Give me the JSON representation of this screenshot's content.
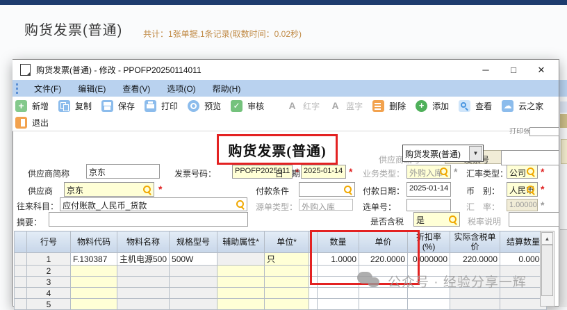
{
  "page": {
    "title": "购货发票(普通)",
    "summary": "共计：1张单据,1条记录(取数时间：0.02秒)"
  },
  "window": {
    "title": "购货发票(普通) - 修改 - PPOFP20250114011",
    "minimize": "─",
    "maximize": "□",
    "close": "✕",
    "menu": [
      "文件(F)",
      "编辑(E)",
      "查看(V)",
      "选项(O)",
      "帮助(H)"
    ],
    "toolbar_row1": [
      {
        "icon": "new-icon",
        "label": "新增"
      },
      {
        "icon": "copy-icon",
        "label": "复制"
      },
      {
        "icon": "save-icon",
        "label": "保存"
      },
      {
        "icon": "print-icon",
        "label": "打印"
      },
      {
        "icon": "preview-icon",
        "label": "预览"
      },
      {
        "icon": "audit-icon",
        "label": "审核"
      },
      {
        "icon": "letter-a-icon",
        "label": "红字",
        "disabled": true
      },
      {
        "icon": "letter-a-icon",
        "label": "蓝字",
        "disabled": true
      },
      {
        "icon": "delete-icon",
        "label": "删除"
      },
      {
        "icon": "add-icon",
        "label": "添加"
      },
      {
        "icon": "magnifier-icon",
        "label": "查看"
      },
      {
        "icon": "cloud-icon",
        "label": "云之家"
      }
    ],
    "toolbar_row2": [
      {
        "icon": "exit-icon",
        "label": "退出"
      }
    ]
  },
  "form": {
    "banner": "购货发票(普通)",
    "bill_type_value": "购货发票(普通)",
    "print_count_label": "打印张数",
    "fields": {
      "supplier_no": {
        "label": "供应商编号",
        "value": ""
      },
      "invoice_no": {
        "label": "发票号",
        "value": ""
      },
      "supplier_abbr": {
        "label": "供应商简称",
        "value": "京东"
      },
      "invoice_code": {
        "label": "发票号码：",
        "value": "PPOFP2025011"
      },
      "date": {
        "label": "日　期：",
        "value": "2025-01-14"
      },
      "biz_type": {
        "label": "业务类型：",
        "value": "外购入库"
      },
      "rate_type": {
        "label": "汇率类型：",
        "value": "公司"
      },
      "supplier": {
        "label": "供应商",
        "value": "京东"
      },
      "pay_terms": {
        "label": "付款条件",
        "value": ""
      },
      "pay_date": {
        "label": "付款日期：",
        "value": "2025-01-14"
      },
      "currency": {
        "label": "币　别：",
        "value": "人民币"
      },
      "account": {
        "label": "往来科目：",
        "value": "应付账款_人民币_货款"
      },
      "source_type": {
        "label": "源单类型：",
        "value": "外购入库"
      },
      "select_no": {
        "label": "选单号：",
        "value": ""
      },
      "ex_rate": {
        "label": "汇　率：",
        "value": "1.000000"
      },
      "summary": {
        "label": "摘要：",
        "value": ""
      },
      "tax_included": {
        "label": "是否含税",
        "value": "是"
      },
      "tax_note": {
        "label": "税率说明",
        "value": ""
      }
    }
  },
  "table": {
    "columns": [
      "行号",
      "物料代码",
      "物料名称",
      "规格型号",
      "辅助属性*",
      "单位*",
      "数量",
      "单价",
      "折扣率(%)",
      "实际含税单价",
      "结算数量"
    ],
    "rows": [
      {
        "cells": [
          "1",
          "F.130387",
          "主机电源500",
          "500W",
          "",
          "只",
          "1.0000",
          "220.0000",
          "0.000000",
          "220.0000",
          "0.0000"
        ]
      },
      {
        "cells": [
          "2",
          "",
          "",
          "",
          "",
          "",
          "",
          "",
          "",
          "",
          ""
        ]
      },
      {
        "cells": [
          "3",
          "",
          "",
          "",
          "",
          "",
          "",
          "",
          "",
          "",
          ""
        ]
      },
      {
        "cells": [
          "4",
          "",
          "",
          "",
          "",
          "",
          "",
          "",
          "",
          "",
          ""
        ]
      },
      {
        "cells": [
          "5",
          "",
          "",
          "",
          "",
          "",
          "",
          "",
          "",
          "",
          ""
        ]
      }
    ]
  },
  "watermark": {
    "text": "公众号 · 经验分享一辉"
  },
  "colors": {
    "highlight_red": "#e32222",
    "lookup_yellow": "#f0a800",
    "required_red": "#e02020",
    "topbar_navy": "#1e3c6e"
  }
}
